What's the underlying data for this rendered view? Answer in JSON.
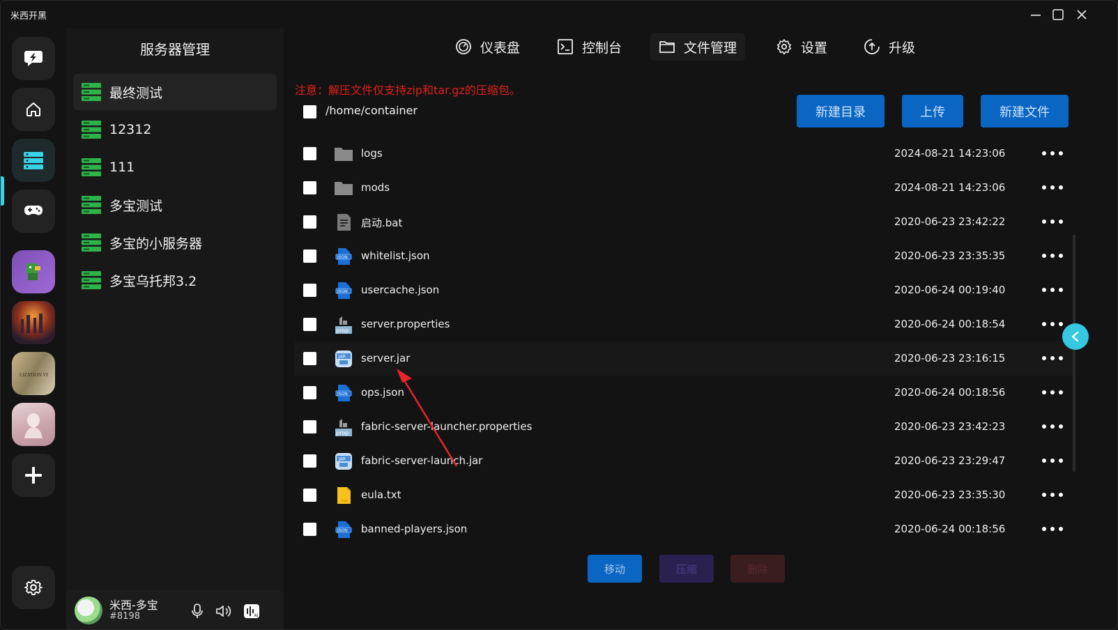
{
  "app": {
    "title": "米西开黑"
  },
  "rail": {
    "items": [
      {
        "icon": "lightning-chat-icon"
      },
      {
        "icon": "home-icon"
      },
      {
        "icon": "server-icon"
      },
      {
        "icon": "gamepad-icon"
      },
      {
        "icon": "game-avatar-1"
      },
      {
        "icon": "game-avatar-2"
      },
      {
        "icon": "game-avatar-3"
      },
      {
        "icon": "game-avatar-4"
      },
      {
        "icon": "plus-icon"
      }
    ],
    "settings_icon": "gear-icon"
  },
  "server_panel": {
    "title": "服务器管理",
    "servers": [
      {
        "label": "最终测试"
      },
      {
        "label": "12312"
      },
      {
        "label": "111"
      },
      {
        "label": "多宝测试"
      },
      {
        "label": "多宝的小服务器"
      },
      {
        "label": "多宝乌托邦3.2"
      }
    ]
  },
  "user": {
    "name": "米西-多宝",
    "tag": "#8198"
  },
  "tabs": [
    {
      "label": "仪表盘",
      "icon": "dashboard-icon"
    },
    {
      "label": "控制台",
      "icon": "terminal-icon"
    },
    {
      "label": "文件管理",
      "icon": "folder-icon"
    },
    {
      "label": "设置",
      "icon": "gear-icon"
    },
    {
      "label": "升级",
      "icon": "upgrade-icon"
    }
  ],
  "files": {
    "notice": "注意：解压文件仅支持zip和tar.gz的压缩包。",
    "path": "/home/container",
    "actions": {
      "new_dir": "新建目录",
      "upload": "上传",
      "new_file": "新建文件"
    },
    "rows": [
      {
        "name": "logs",
        "date": "2024-08-21 14:23:06",
        "icon": "folder-icon"
      },
      {
        "name": "mods",
        "date": "2024-08-21 14:23:06",
        "icon": "folder-icon"
      },
      {
        "name": "启动.bat",
        "date": "2020-06-23 23:42:22",
        "icon": "text-file-icon"
      },
      {
        "name": "whitelist.json",
        "date": "2020-06-23 23:35:35",
        "icon": "json-file-icon"
      },
      {
        "name": "usercache.json",
        "date": "2020-06-24 00:19:40",
        "icon": "json-file-icon"
      },
      {
        "name": "server.properties",
        "date": "2020-06-24 00:18:54",
        "icon": "prop-file-icon"
      },
      {
        "name": "server.jar",
        "date": "2020-06-23 23:16:15",
        "icon": "jar-file-icon"
      },
      {
        "name": "ops.json",
        "date": "2020-06-24 00:18:56",
        "icon": "json-file-icon"
      },
      {
        "name": "fabric-server-launcher.properties",
        "date": "2020-06-23 23:42:23",
        "icon": "prop-file-icon"
      },
      {
        "name": "fabric-server-launch.jar",
        "date": "2020-06-23 23:29:47",
        "icon": "jar-file-icon"
      },
      {
        "name": "eula.txt",
        "date": "2020-06-23 23:35:30",
        "icon": "txt-file-icon"
      },
      {
        "name": "banned-players.json",
        "date": "2020-06-24 00:18:56",
        "icon": "json-file-icon"
      }
    ],
    "bottom": {
      "move": "移动",
      "compress": "压缩",
      "delete": "删除"
    }
  },
  "colors": {
    "accent": "#0b66c3",
    "rail_indicator": "#38d3e6",
    "notice": "#e0221a",
    "server_icon": "#2db34a"
  }
}
